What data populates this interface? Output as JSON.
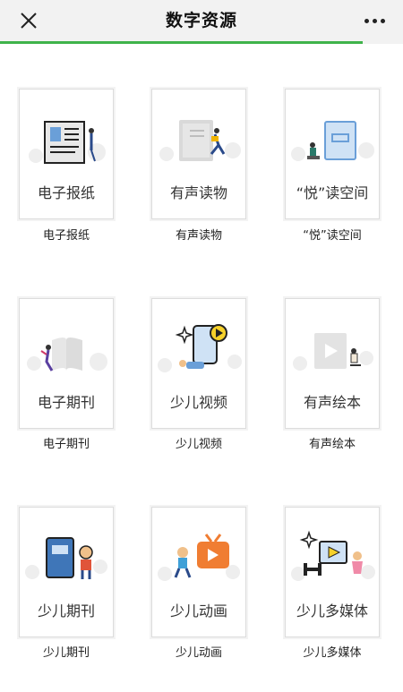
{
  "header": {
    "title": "数字资源"
  },
  "page_load_progress": 0.9,
  "items": [
    {
      "card_label": "电子报纸",
      "caption": "电子报纸",
      "icon": "newspaper-icon"
    },
    {
      "card_label": "有声读物",
      "caption": "有声读物",
      "icon": "audiobook-icon"
    },
    {
      "card_label": "“悦”读空间",
      "caption": "“悦”读空间",
      "icon": "reading-space-icon"
    },
    {
      "card_label": "电子期刊",
      "caption": "电子期刊",
      "icon": "ejournal-icon"
    },
    {
      "card_label": "少儿视频",
      "caption": "少儿视频",
      "icon": "kids-video-icon"
    },
    {
      "card_label": "有声绘本",
      "caption": "有声绘本",
      "icon": "audio-picturebook-icon"
    },
    {
      "card_label": "少儿期刊",
      "caption": "少儿期刊",
      "icon": "kids-journal-icon"
    },
    {
      "card_label": "少儿动画",
      "caption": "少儿动画",
      "icon": "kids-animation-icon"
    },
    {
      "card_label": "少儿多媒体",
      "caption": "少儿多媒体",
      "icon": "kids-multimedia-icon"
    }
  ],
  "colors": {
    "accent": "#3fb34a",
    "top_bar": "#f2f2f2",
    "illustration_blue": "#6a9fd8",
    "illustration_orange": "#f07d32"
  }
}
